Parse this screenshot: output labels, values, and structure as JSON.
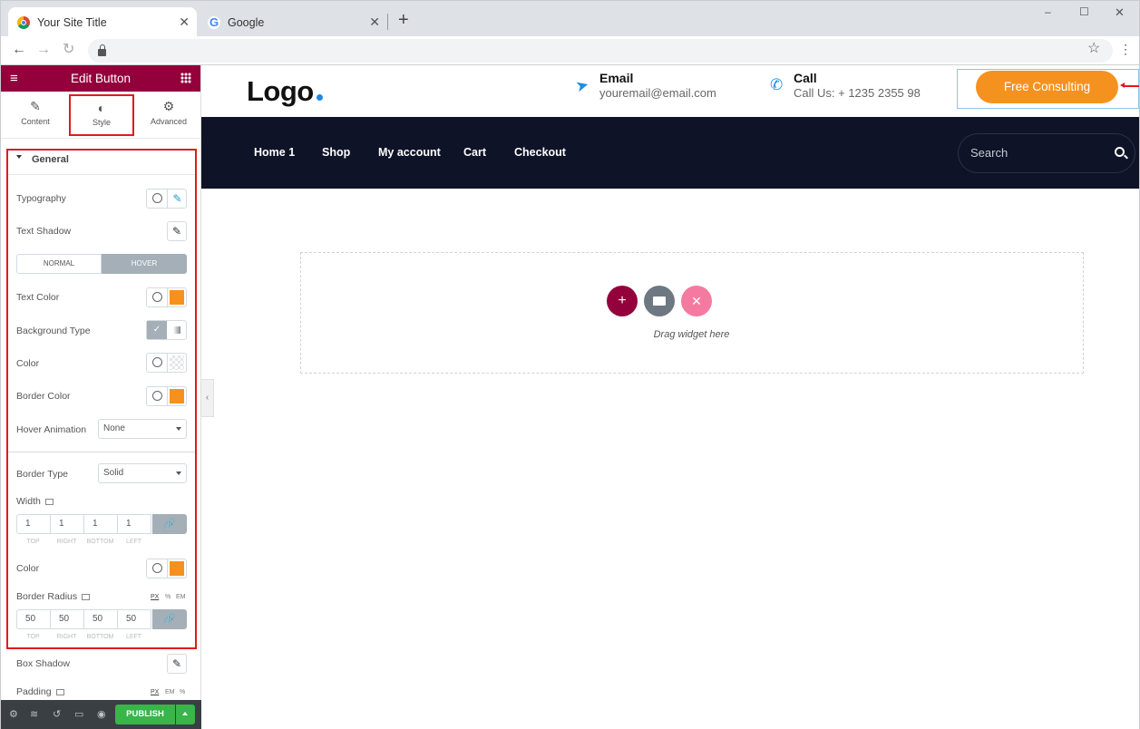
{
  "browser": {
    "tabs": [
      {
        "title": "Your Site Title",
        "active": true
      },
      {
        "title": "Google",
        "active": false
      }
    ],
    "new_tab_label": "+",
    "window_controls": [
      "–",
      "☐",
      "✕"
    ]
  },
  "editor": {
    "header_title": "Edit Button",
    "tabs": [
      {
        "label": "Content",
        "icon": "pencil-icon"
      },
      {
        "label": "Style",
        "icon": "contrast-icon",
        "active": true
      },
      {
        "label": "Advanced",
        "icon": "gear-icon"
      }
    ],
    "section_title": "General",
    "controls": {
      "typography": "Typography",
      "text_shadow": "Text Shadow",
      "state_tabs": [
        "NORMAL",
        "HOVER"
      ],
      "active_state": "HOVER",
      "text_color": "Text Color",
      "background_type": "Background Type",
      "color": "Color",
      "border_color": "Border Color",
      "hover_animation": "Hover Animation",
      "hover_animation_value": "None",
      "border_type": "Border Type",
      "border_type_value": "Solid",
      "width": "Width",
      "width_values": [
        "1",
        "1",
        "1",
        "1"
      ],
      "dim_labels": [
        "TOP",
        "RIGHT",
        "BOTTOM",
        "LEFT"
      ],
      "border_color2": "Color",
      "border_radius": "Border Radius",
      "border_radius_units": [
        "PX",
        "%",
        "EM"
      ],
      "border_radius_values": [
        "50",
        "50",
        "50",
        "50"
      ],
      "box_shadow": "Box Shadow",
      "padding": "Padding",
      "padding_units": [
        "PX",
        "EM",
        "%"
      ]
    },
    "accent_color": "#f5921f",
    "footer": {
      "publish_label": "PUBLISH"
    }
  },
  "site": {
    "logo": "Logo",
    "email_label": "Email",
    "email_value": "youremail@email.com",
    "call_label": "Call",
    "call_value": "Call Us: + 1235 2355 98",
    "cta_label": "Free Consulting",
    "menu": [
      "Home 1",
      "Shop",
      "My account",
      "Cart",
      "Checkout"
    ],
    "search_placeholder": "Search",
    "drop_text": "Drag widget here",
    "navbar_color": "#0e1327",
    "cta_color": "#f5921f"
  }
}
